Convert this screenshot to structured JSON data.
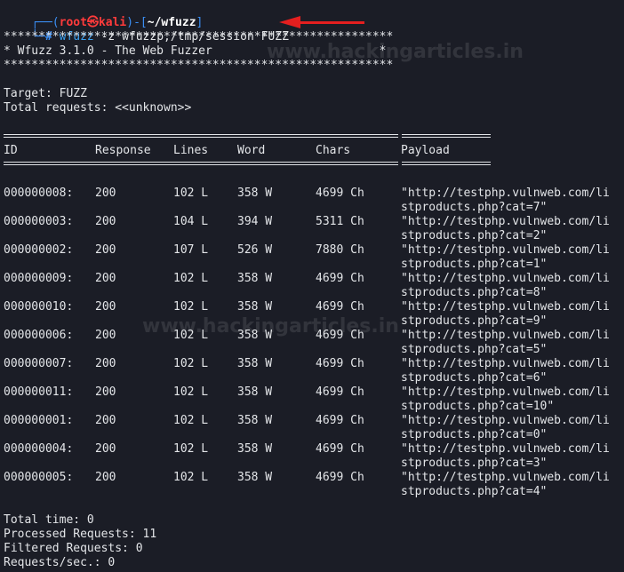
{
  "prompt": {
    "user": "root",
    "at_symbol": "㉿",
    "host": "kali",
    "path": "~/wfuzz",
    "hash": "#",
    "command_name": "wfuzz",
    "command_args": " -z wfuzzp,/tmp/session FUZZ"
  },
  "banner": {
    "stars": "********************************************************",
    "title_line": "* Wfuzz 3.1.0 - The Web Fuzzer                        *"
  },
  "info": {
    "target": "Target: FUZZ",
    "total_requests": "Total requests: <<unknown>>"
  },
  "table": {
    "headers": [
      "ID",
      "Response",
      "Lines",
      "Word",
      "Chars",
      "Payload"
    ],
    "rows": [
      {
        "id": "000000008:",
        "response": "200",
        "lines": "102 L",
        "word": "358 W",
        "chars": "4699 Ch",
        "payload1": "\"http://testphp.vulnweb.com/li",
        "payload2": "stproducts.php?cat=7\""
      },
      {
        "id": "000000003:",
        "response": "200",
        "lines": "104 L",
        "word": "394 W",
        "chars": "5311 Ch",
        "payload1": "\"http://testphp.vulnweb.com/li",
        "payload2": "stproducts.php?cat=2\""
      },
      {
        "id": "000000002:",
        "response": "200",
        "lines": "107 L",
        "word": "526 W",
        "chars": "7880 Ch",
        "payload1": "\"http://testphp.vulnweb.com/li",
        "payload2": "stproducts.php?cat=1\""
      },
      {
        "id": "000000009:",
        "response": "200",
        "lines": "102 L",
        "word": "358 W",
        "chars": "4699 Ch",
        "payload1": "\"http://testphp.vulnweb.com/li",
        "payload2": "stproducts.php?cat=8\""
      },
      {
        "id": "000000010:",
        "response": "200",
        "lines": "102 L",
        "word": "358 W",
        "chars": "4699 Ch",
        "payload1": "\"http://testphp.vulnweb.com/li",
        "payload2": "stproducts.php?cat=9\""
      },
      {
        "id": "000000006:",
        "response": "200",
        "lines": "102 L",
        "word": "358 W",
        "chars": "4699 Ch",
        "payload1": "\"http://testphp.vulnweb.com/li",
        "payload2": "stproducts.php?cat=5\""
      },
      {
        "id": "000000007:",
        "response": "200",
        "lines": "102 L",
        "word": "358 W",
        "chars": "4699 Ch",
        "payload1": "\"http://testphp.vulnweb.com/li",
        "payload2": "stproducts.php?cat=6\""
      },
      {
        "id": "000000011:",
        "response": "200",
        "lines": "102 L",
        "word": "358 W",
        "chars": "4699 Ch",
        "payload1": "\"http://testphp.vulnweb.com/li",
        "payload2": "stproducts.php?cat=10\""
      },
      {
        "id": "000000001:",
        "response": "200",
        "lines": "102 L",
        "word": "358 W",
        "chars": "4699 Ch",
        "payload1": "\"http://testphp.vulnweb.com/li",
        "payload2": "stproducts.php?cat=0\""
      },
      {
        "id": "000000004:",
        "response": "200",
        "lines": "102 L",
        "word": "358 W",
        "chars": "4699 Ch",
        "payload1": "\"http://testphp.vulnweb.com/li",
        "payload2": "stproducts.php?cat=3\""
      },
      {
        "id": "000000005:",
        "response": "200",
        "lines": "102 L",
        "word": "358 W",
        "chars": "4699 Ch",
        "payload1": "\"http://testphp.vulnweb.com/li",
        "payload2": "stproducts.php?cat=4\""
      }
    ]
  },
  "summary": {
    "total_time": "Total time: 0",
    "processed": "Processed Requests: 11",
    "filtered": "Filtered Requests: 0",
    "rate": "Requests/sec.: 0"
  },
  "watermark": {
    "text1": "www.hackingarticles.in",
    "text2": "www.hackingarticles.in"
  },
  "colors": {
    "background": "#1b1d26",
    "prompt_frame": "#3b8ff5",
    "user_host": "#ff3b3b",
    "arrow": "#e51f1f"
  }
}
